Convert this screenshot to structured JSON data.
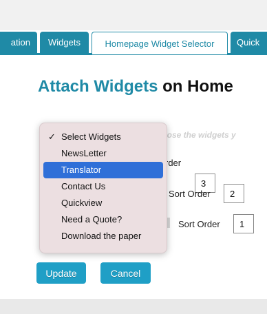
{
  "tabs": [
    {
      "label": "ation"
    },
    {
      "label": "Widgets"
    },
    {
      "label": "Homepage Widget Selector"
    },
    {
      "label": "Quick"
    }
  ],
  "title": {
    "highlight": "Attach Widgets",
    "rest": "on Home"
  },
  "hint": "hoose the widgets y",
  "rows": [
    {
      "label": "rder",
      "value": "3"
    },
    {
      "label": "Sort Order",
      "value": "2"
    },
    {
      "label": "Sort Order",
      "value": "1"
    }
  ],
  "dropdown": {
    "selected": "Select Widgets",
    "highlighted": "Translator",
    "options": [
      "Select Widgets",
      "NewsLetter",
      "Translator",
      "Contact Us",
      "Quickview",
      "Need a Quote?",
      "Download the paper"
    ]
  },
  "buttons": {
    "update": "Update",
    "cancel": "Cancel"
  },
  "colors": {
    "accent": "#1f8aa6",
    "button": "#1f9fc6",
    "highlight": "#2f6fd8"
  }
}
